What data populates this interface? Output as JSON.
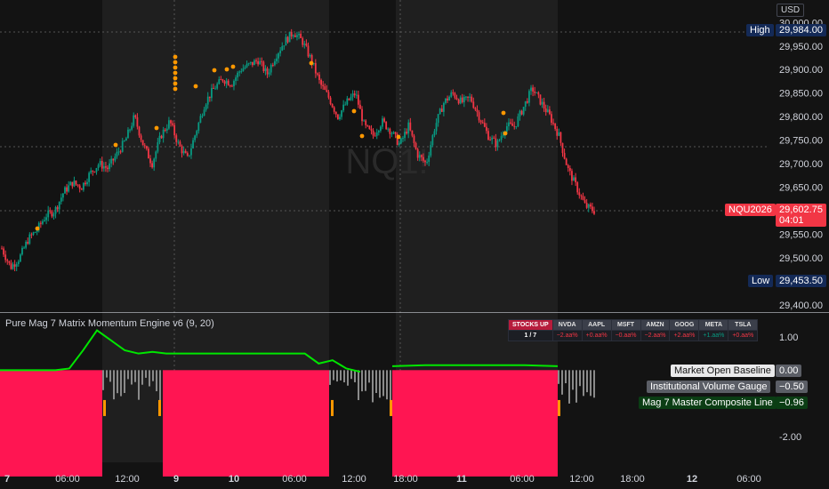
{
  "currency": "USD",
  "watermark": "NQ1!",
  "price_axis": {
    "ticks": [
      "30,000.00",
      "29,950.00",
      "29,900.00",
      "29,850.00",
      "29,800.00",
      "29,750.00",
      "29,700.00",
      "29,650.00",
      "29,600.00",
      "29,550.00",
      "29,500.00",
      "29,400.00"
    ]
  },
  "markers": {
    "high": {
      "label": "High",
      "value": "29,984.00"
    },
    "low": {
      "label": "Low",
      "value": "29,453.50"
    },
    "last": {
      "label": "NQU2026",
      "value": "29,602.75",
      "countdown": "04:01"
    }
  },
  "indicator": {
    "title": "Pure Mag 7 Matrix Momentum Engine v6 (9, 20)",
    "axis_ticks": [
      "1.00",
      "-2.00"
    ],
    "labels": [
      {
        "name": "Market Open Baseline",
        "value": "0.00"
      },
      {
        "name": "Institutional Volume Gauge",
        "value": "−0.50"
      },
      {
        "name": "Mag 7 Master Composite Line",
        "value": "−0.96"
      }
    ]
  },
  "matrix": {
    "header": "STOCKS UP",
    "tickers": [
      "NVDA",
      "AAPL",
      "MSFT",
      "AMZN",
      "GOOG",
      "META",
      "TSLA"
    ],
    "count": "1 / 7",
    "changes": [
      "−2.aa%",
      "+0.aa%",
      "−0.aa%",
      "−2.aa%",
      "+2.aa%",
      "+1.aa%",
      "+0.aa%"
    ]
  },
  "time_axis": {
    "ticks": [
      "7",
      "06:00",
      "12:00",
      "9",
      "10",
      "06:00",
      "12:00",
      "18:00",
      "11",
      "06:00",
      "12:00",
      "18:00",
      "12",
      "06:00"
    ]
  },
  "colors": {
    "up": "#089981",
    "down": "#f23645",
    "session_shade": "#1f1f1f",
    "composite": "#00e600",
    "histogram": "#ff1552",
    "dots": "#ff9800"
  },
  "chart_data": {
    "type": "candlestick",
    "title": "",
    "ylim": [
      29400,
      30010
    ],
    "close_path": [
      29520,
      29480,
      29500,
      29540,
      29560,
      29590,
      29600,
      29640,
      29660,
      29650,
      29680,
      29700,
      29690,
      29720,
      29750,
      29800,
      29740,
      29700,
      29760,
      29790,
      29740,
      29710,
      29770,
      29830,
      29860,
      29880,
      29870,
      29900,
      29910,
      29920,
      29890,
      29930,
      29960,
      29980,
      29960,
      29920,
      29870,
      29840,
      29800,
      29830,
      29850,
      29780,
      29760,
      29790,
      29770,
      29740,
      29780,
      29720,
      29700,
      29780,
      29830,
      29850,
      29830,
      29840,
      29800,
      29760,
      29740,
      29780,
      29780,
      29820,
      29860,
      29830,
      29800,
      29760,
      29690,
      29650,
      29610,
      29600
    ],
    "indicator": {
      "composite_line": [
        0.0,
        0.0,
        0.0,
        0.0,
        0.0,
        0.05,
        0.6,
        1.2,
        0.9,
        0.6,
        0.5,
        0.55,
        0.5,
        0.5,
        0.5,
        0.5,
        0.5,
        0.5,
        0.5,
        0.5,
        0.5,
        0.5,
        0.5,
        0.2,
        0.3,
        0.05,
        -0.05
      ],
      "baseline": 0.0,
      "histogram_value": -2.4
    }
  }
}
